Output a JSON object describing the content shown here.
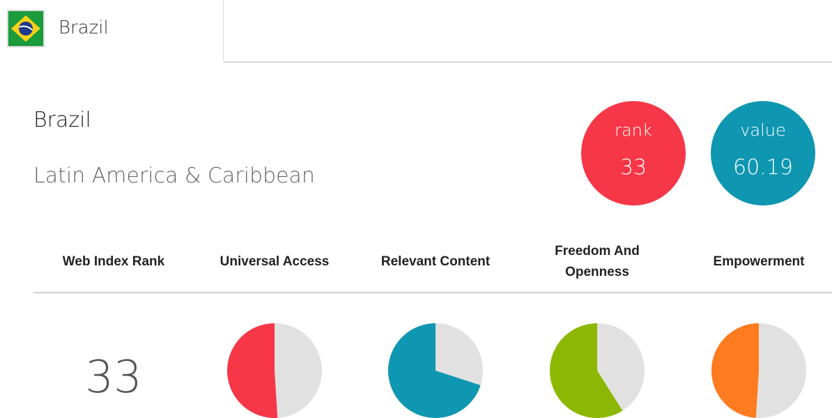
{
  "topbar": {
    "country_select": {
      "label": "Brazil",
      "flag_icon": "brazil-flag-icon"
    }
  },
  "country": {
    "name": "Brazil",
    "region": "Latin America & Caribbean"
  },
  "badges": {
    "rank": {
      "label": "rank",
      "value": "33",
      "color": "#f63747"
    },
    "value": {
      "label": "value",
      "value": "60.19",
      "color": "#0f96b1"
    }
  },
  "columns": [
    {
      "label": "Web Index Rank"
    },
    {
      "label": "Universal Access"
    },
    {
      "label": "Relevant Content"
    },
    {
      "label": "Freedom And Openness"
    },
    {
      "label": "Empowerment"
    }
  ],
  "web_index_rank": "33",
  "chart_data": {
    "type": "pie",
    "series": [
      {
        "name": "Universal Access",
        "value_percent": 51,
        "color": "#f63747",
        "rest_color": "#e1e1e1"
      },
      {
        "name": "Relevant Content",
        "value_percent": 70,
        "color": "#0f96b1",
        "rest_color": "#e1e1e1"
      },
      {
        "name": "Freedom And Openness",
        "value_percent": 59,
        "color": "#8cb804",
        "rest_color": "#e1e1e1"
      },
      {
        "name": "Empowerment",
        "value_percent": 49,
        "color": "#ff7b1f",
        "rest_color": "#e1e1e1"
      }
    ]
  }
}
